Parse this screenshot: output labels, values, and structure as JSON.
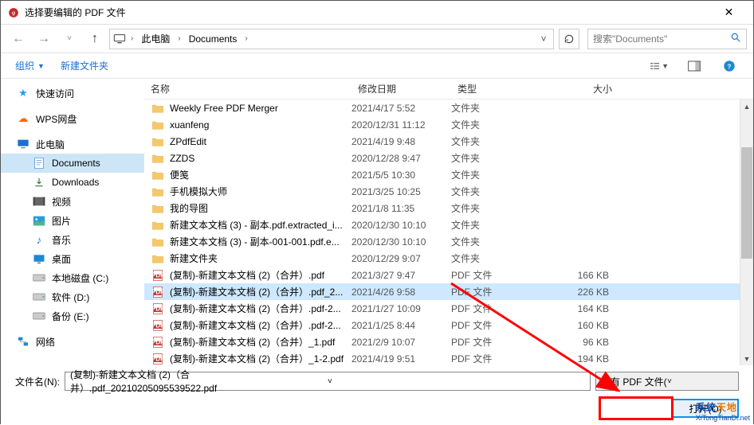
{
  "title": "选择要编辑的 PDF 文件",
  "breadcrumb": {
    "root": "此电脑",
    "folder": "Documents"
  },
  "search": {
    "placeholder": "搜索\"Documents\""
  },
  "toolbar": {
    "organize": "组织",
    "newfolder": "新建文件夹"
  },
  "sidebar": {
    "quick": "快速访问",
    "wps": "WPS网盘",
    "pc": "此电脑",
    "documents": "Documents",
    "downloads": "Downloads",
    "video": "视频",
    "pictures": "图片",
    "music": "音乐",
    "desktop": "桌面",
    "driveC": "本地磁盘 (C:)",
    "driveD": "软件 (D:)",
    "driveE": "备份 (E:)",
    "network": "网络"
  },
  "columns": {
    "name": "名称",
    "date": "修改日期",
    "type": "类型",
    "size": "大小"
  },
  "rows": [
    {
      "icon": "folder",
      "name": "Weekly Free PDF Merger",
      "date": "2021/4/17 5:52",
      "type": "文件夹",
      "size": ""
    },
    {
      "icon": "folder",
      "name": "xuanfeng",
      "date": "2020/12/31 11:12",
      "type": "文件夹",
      "size": ""
    },
    {
      "icon": "folder",
      "name": "ZPdfEdit",
      "date": "2021/4/19 9:48",
      "type": "文件夹",
      "size": ""
    },
    {
      "icon": "folder",
      "name": "ZZDS",
      "date": "2020/12/28 9:47",
      "type": "文件夹",
      "size": ""
    },
    {
      "icon": "folder",
      "name": "便笺",
      "date": "2021/5/5 10:30",
      "type": "文件夹",
      "size": ""
    },
    {
      "icon": "folder",
      "name": "手机模拟大师",
      "date": "2021/3/25 10:25",
      "type": "文件夹",
      "size": ""
    },
    {
      "icon": "folder",
      "name": "我的导图",
      "date": "2021/1/8 11:35",
      "type": "文件夹",
      "size": ""
    },
    {
      "icon": "folder",
      "name": "新建文本文档 (3) - 副本.pdf.extracted_i...",
      "date": "2020/12/30 10:10",
      "type": "文件夹",
      "size": ""
    },
    {
      "icon": "folder",
      "name": "新建文本文档 (3) - 副本-001-001.pdf.e...",
      "date": "2020/12/30 10:10",
      "type": "文件夹",
      "size": ""
    },
    {
      "icon": "folder",
      "name": "新建文件夹",
      "date": "2020/12/29 9:07",
      "type": "文件夹",
      "size": ""
    },
    {
      "icon": "pdf",
      "name": "(复制)-新建文本文档 (2)（合并）.pdf",
      "date": "2021/3/27 9:47",
      "type": "PDF 文件",
      "size": "166 KB"
    },
    {
      "icon": "pdf",
      "name": "(复制)-新建文本文档 (2)（合并）.pdf_2...",
      "date": "2021/4/26 9:58",
      "type": "PDF 文件",
      "size": "226 KB",
      "selected": true
    },
    {
      "icon": "pdf",
      "name": "(复制)-新建文本文档 (2)（合并）.pdf-2...",
      "date": "2021/1/27 10:09",
      "type": "PDF 文件",
      "size": "164 KB"
    },
    {
      "icon": "pdf",
      "name": "(复制)-新建文本文档 (2)（合并）.pdf-2...",
      "date": "2021/1/25 8:44",
      "type": "PDF 文件",
      "size": "160 KB"
    },
    {
      "icon": "pdf",
      "name": "(复制)-新建文本文档 (2)（合并）_1.pdf",
      "date": "2021/2/9 10:07",
      "type": "PDF 文件",
      "size": "96 KB"
    },
    {
      "icon": "pdf",
      "name": "(复制)-新建文本文档 (2)（合并）_1-2.pdf",
      "date": "2021/4/19 9:51",
      "type": "PDF 文件",
      "size": "194 KB"
    }
  ],
  "filename_label": "文件名(N):",
  "filename_value": "(复制)-新建文本文档 (2)（合并）.pdf_20210205095539522.pdf",
  "filter_value": "所有 PDF 文件(*.pdf, *.pdt)",
  "open_label": "打开(O)",
  "watermark": {
    "line1a": "系统",
    "line1b": "天地",
    "line2": "XiTongTianDi.net"
  }
}
